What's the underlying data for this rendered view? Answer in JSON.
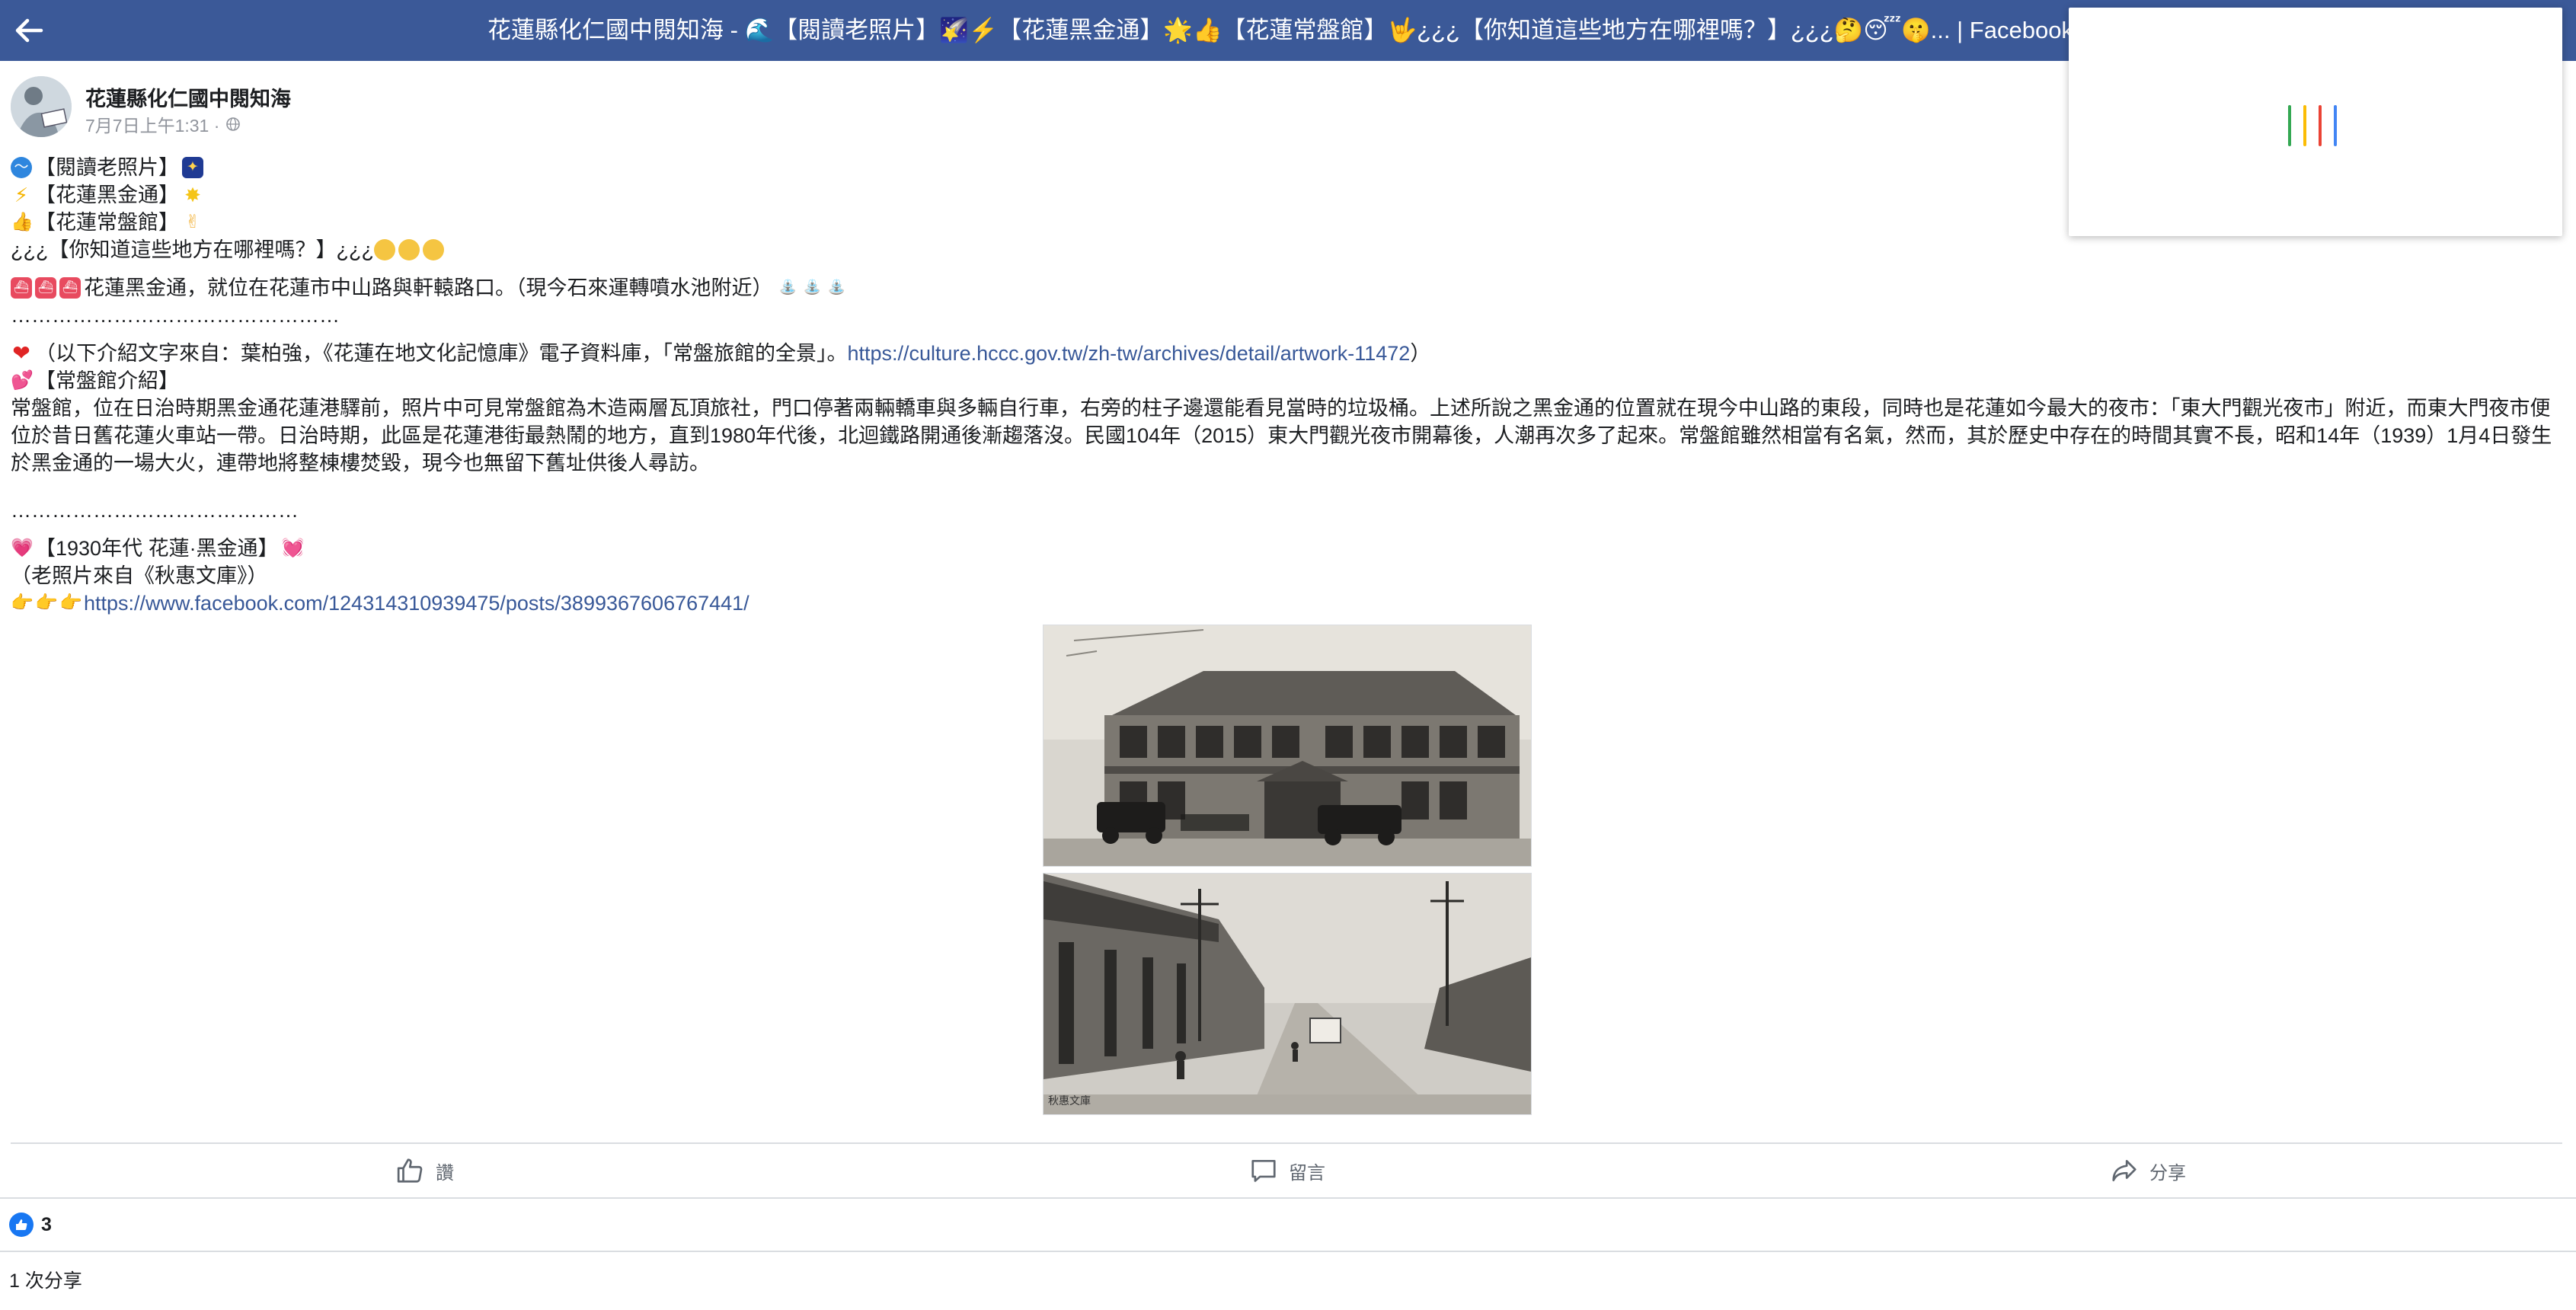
{
  "topbar": {
    "title": "花蓮縣化仁國中閱知海 - 🌊【閱讀老照片】🌠⚡️【花蓮黑金通】🌟👍【花蓮常盤館】🤟¿¿¿【你知道這些地方在哪裡嗎？】¿¿¿🤔😴🤫... | Facebook",
    "back_icon": "arrow-left-icon",
    "color": "#3b5998"
  },
  "popup": {
    "bar_colors": [
      "#34a853",
      "#fbbc05",
      "#ea4335",
      "#4285f4"
    ]
  },
  "post": {
    "author": "花蓮縣化仁國中閱知海",
    "timestamp": "7月7日上午1:31 ·",
    "privacy_icon": "globe-icon",
    "lines": {
      "l1": "【閱讀老照片】",
      "l2": "【花蓮黑金通】",
      "l3": "【花蓮常盤館】",
      "l4_text": "¿¿¿【你知道這些地方在哪裡嗎？】¿¿¿",
      "l5": "花蓮黑金通，就位在花蓮市中山路與軒轅路口。（現今石來運轉噴水池附近）",
      "dots1": "…………………………………………",
      "source_prefix": "（以下介紹文字來自：葉柏強，《花蓮在地文化記憶庫》電子資料庫，「常盤旅館的全景」。",
      "source_link": "https://culture.hccc.gov.tw/zh-tw/archives/detail/artwork-11472",
      "source_suffix": "）",
      "intro_heading": "【常盤館介紹】",
      "intro_body": "常盤館，位在日治時期黑金通花蓮港驛前，照片中可見常盤館為木造兩層瓦頂旅社，門口停著兩輛轎車與多輛自行車，右旁的柱子邊還能看見當時的垃圾桶。上述所說之黑金通的位置就在現今中山路的東段，同時也是花蓮如今最大的夜市：「東大門觀光夜市」附近，而東大門夜市便位於昔日舊花蓮火車站一帶。日治時期，此區是花蓮港街最熱鬧的地方，直到1980年代後，北迴鐵路開通後漸趨落沒。民國104年（2015）東大門觀光夜市開幕後，人潮再次多了起來。常盤館雖然相當有名氣，然而，其於歷史中存在的時間其實不長，昭和14年（1939）1月4日發生於黑金通的一場大火，連帶地將整棟樓焚毀，現今也無留下舊址供後人尋訪。",
      "dots2": "……………………………………",
      "era_heading": "【1930年代 花蓮·黑金通】",
      "photo_source": "（老照片來自《秋惠文庫》）",
      "fb_link": "https://www.facebook.com/124314310939475/posts/3899367606767441/"
    },
    "photo2_caption": "秋惠文庫"
  },
  "actions": {
    "like_label": "讚",
    "comment_label": "留言",
    "share_label": "分享",
    "like_icon": "thumbs-up-icon",
    "comment_icon": "comment-icon",
    "share_icon": "share-icon"
  },
  "reactions": {
    "count": "3",
    "icon": "like-reaction-icon",
    "color": "#1877f2"
  },
  "shares": {
    "text": "1 次分享"
  }
}
